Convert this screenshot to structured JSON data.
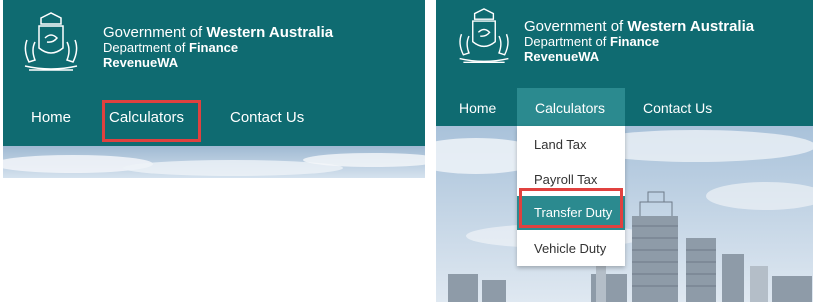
{
  "branding": {
    "line1_prefix": "Government of ",
    "line1_bold": "Western Australia",
    "line2_prefix": "Department of ",
    "line2_bold": "Finance",
    "line3": "RevenueWA"
  },
  "nav": {
    "home": "Home",
    "calculators": "Calculators",
    "contact": "Contact Us"
  },
  "dropdown": {
    "items": [
      "Land Tax",
      "Payroll Tax",
      "Transfer Duty",
      "Vehicle Duty"
    ],
    "active_index": 2
  },
  "colors": {
    "header": "#0f6b71",
    "nav_active": "#2b8a8f",
    "highlight": "#e0413f"
  },
  "icons": {
    "crest": "wa-coat-of-arms-icon"
  }
}
